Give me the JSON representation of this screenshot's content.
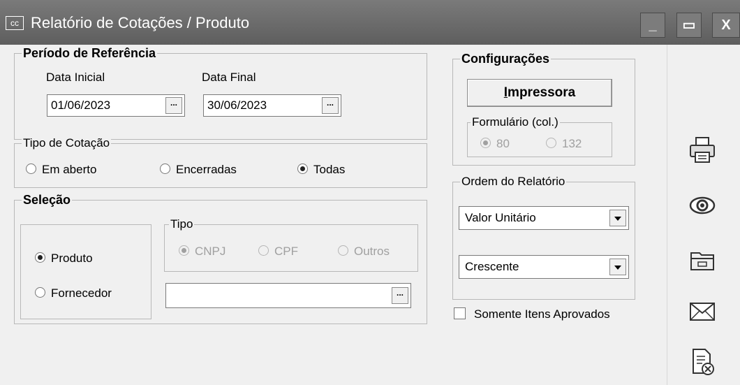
{
  "window": {
    "app_icon_text": "cc",
    "title": "Relatório de Cotações / Produto",
    "minimize": "_",
    "maximize": "▭",
    "close": "X"
  },
  "periodo": {
    "legend": "Período de Referência",
    "data_inicial_label": "Data Inicial",
    "data_inicial_value": "01/06/2023",
    "data_final_label": "Data Final",
    "data_final_value": "30/06/2023",
    "ellipsis": "..."
  },
  "tipo_cotacao": {
    "legend": "Tipo de Cotação",
    "options": [
      "Em aberto",
      "Encerradas",
      "Todas"
    ],
    "selected": "Todas"
  },
  "selecao": {
    "legend": "Seleção",
    "options": [
      "Produto",
      "Fornecedor"
    ],
    "selected": "Produto",
    "tipo_legend": "Tipo",
    "tipo_options": [
      "CNPJ",
      "CPF",
      "Outros"
    ],
    "tipo_selected": "CNPJ",
    "search_value": "",
    "ellipsis": "..."
  },
  "configuracoes": {
    "legend": "Configurações",
    "impressora_button": "Impressora",
    "formulario_legend": "Formulário (col.)",
    "formulario_options": [
      "80",
      "132"
    ],
    "formulario_selected": "80"
  },
  "ordem": {
    "legend": "Ordem do Relatório",
    "field_value": "Valor Unitário",
    "direction_value": "Crescente"
  },
  "somente_aprovados": {
    "label": "Somente Itens Aprovados",
    "checked": false
  },
  "side_icons": [
    "printer-icon",
    "eye-icon",
    "folder-icon",
    "envelope-icon",
    "document-close-icon"
  ]
}
